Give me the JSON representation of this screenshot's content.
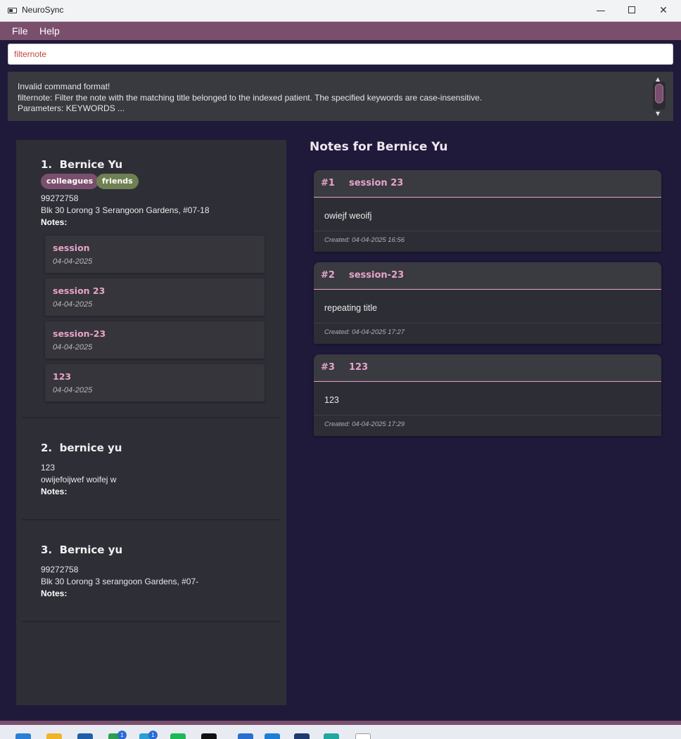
{
  "window": {
    "title": "NeuroSync",
    "controls": {
      "minimize": "minimize",
      "maximize": "maximize",
      "close": "✕"
    }
  },
  "menu": {
    "items": [
      "File",
      "Help"
    ]
  },
  "command": {
    "value": "filternote"
  },
  "result": {
    "text": "Invalid command format!\nfilternote: Filter the note with the matching title belonged to the indexed patient. The specified keywords are case-insensitive.\nParameters: KEYWORDS ..."
  },
  "patients": [
    {
      "index": "1.",
      "name": "Bernice Yu",
      "tags": [
        "colleagues",
        "friends"
      ],
      "phone": "99272758",
      "address": "Blk 30 Lorong 3 Serangoon Gardens, #07-18",
      "notes_label": "Notes:",
      "notes": [
        {
          "title": "session",
          "date": "04-04-2025"
        },
        {
          "title": "session 23",
          "date": "04-04-2025"
        },
        {
          "title": "session-23",
          "date": "04-04-2025"
        },
        {
          "title": "123",
          "date": "04-04-2025"
        }
      ]
    },
    {
      "index": "2.",
      "name": "bernice yu",
      "phone": "123",
      "address": "owijefoijwef woifej w",
      "notes_label": "Notes:"
    },
    {
      "index": "3.",
      "name": "Bernice yu",
      "phone": "99272758",
      "address": "Blk 30 Lorong 3 serangoon Gardens, #07-",
      "notes_label": "Notes:"
    }
  ],
  "notes_panel": {
    "heading": "Notes for Bernice Yu",
    "cards": [
      {
        "num": "#1",
        "title": "session 23",
        "body": "owiejf weoifj",
        "created": "Created: 04-04-2025 16:56"
      },
      {
        "num": "#2",
        "title": "session-23",
        "body": "repeating title",
        "created": "Created: 04-04-2025 17:27"
      },
      {
        "num": "#3",
        "title": "123",
        "body": "123",
        "created": "Created: 04-04-2025 17:29"
      }
    ]
  },
  "taskbar": {
    "badges": [
      "1",
      "1"
    ]
  },
  "colors": {
    "accent": "#7a4f6d",
    "background": "#1f1a3a",
    "panel": "#2e2e37",
    "note_title": "#e7a4c9",
    "tag_friends": "#6f8052",
    "error_text": "#c1453b"
  }
}
